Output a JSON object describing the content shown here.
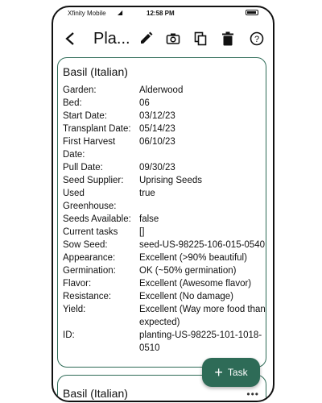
{
  "status_bar": {
    "carrier": "Xfinity Mobile",
    "time": "12:58 PM"
  },
  "app_bar": {
    "title": "Pla...",
    "icons": [
      "back-arrow-icon",
      "edit-pencil-icon",
      "camera-icon",
      "copy-icon",
      "delete-trash-icon",
      "help-icon"
    ]
  },
  "planting": {
    "title": "Basil (Italian)",
    "rows": [
      {
        "label": "Garden:",
        "value": "Alderwood"
      },
      {
        "label": "Bed:",
        "value": "06"
      },
      {
        "label": "Start Date:",
        "value": "03/12/23"
      },
      {
        "label": "Transplant Date:",
        "value": "05/14/23"
      },
      {
        "label": "First Harvest Date:",
        "value": "06/10/23"
      },
      {
        "label": "Pull Date:",
        "value": "09/30/23"
      },
      {
        "label": "Seed Supplier:",
        "value": "Uprising Seeds"
      },
      {
        "label": "Used Greenhouse:",
        "value": "true"
      },
      {
        "label": "Seeds Available:",
        "value": "false"
      },
      {
        "label": "Current tasks",
        "value": "[]"
      },
      {
        "label": "Sow Seed:",
        "value": "seed-US-98225-106-015-0540"
      },
      {
        "label": "Appearance:",
        "value": "Excellent (>90% beautiful)"
      },
      {
        "label": "Germination:",
        "value": "OK (~50% germination)"
      },
      {
        "label": "Flavor:",
        "value": "Excellent (Awesome flavor)"
      },
      {
        "label": "Resistance:",
        "value": "Excellent (No damage)"
      },
      {
        "label": "Yield:",
        "value": "Excellent (Way more food than expected)"
      },
      {
        "label": "ID:",
        "value": "planting-US-98225-101-1018-0510"
      }
    ]
  },
  "next_planting": {
    "title": "Basil (Italian)"
  },
  "fab": {
    "label": "Task"
  },
  "colors": {
    "accent": "#2e6b57"
  }
}
